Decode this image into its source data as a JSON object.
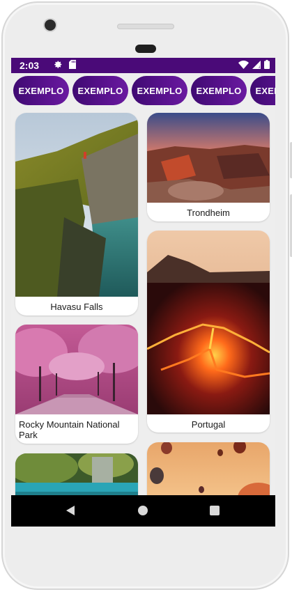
{
  "status": {
    "time": "2:03"
  },
  "chips": [
    "EXEMPLO",
    "EXEMPLO",
    "EXEMPLO",
    "EXEMPLO",
    "EXEMPLO"
  ],
  "cards": {
    "havasu": "Havasu Falls",
    "trondheim": "Trondheim",
    "rocky": "Rocky Mountain National Park",
    "portugal": "Portugal"
  },
  "colors": {
    "primary_dark": "#4a0a78",
    "chip": "#5a128f"
  },
  "icons": [
    "settings-icon",
    "sd-card-icon",
    "wifi-icon",
    "signal-icon",
    "battery-icon",
    "back-icon",
    "home-icon",
    "recents-icon"
  ]
}
